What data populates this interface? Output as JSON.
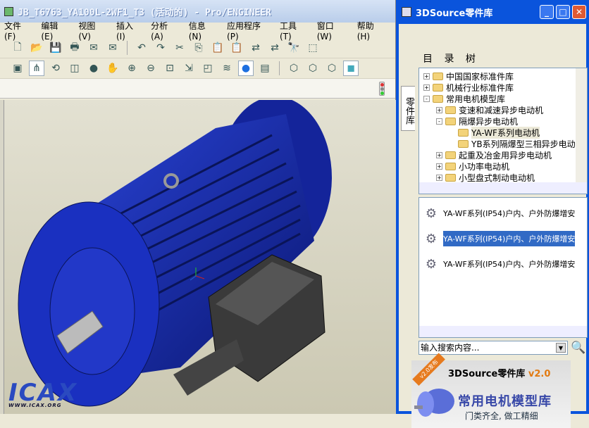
{
  "window": {
    "title": "JB_T6763_YA100L-2WF1_T3 (活动的) - Pro/ENGINEER"
  },
  "menu": [
    "文件(F)",
    "编辑(E)",
    "视图(V)",
    "插入(I)",
    "分析(A)",
    "信息(N)",
    "应用程序(P)",
    "工具(T)",
    "窗口(W)",
    "帮助(H)"
  ],
  "panel": {
    "title": "3DSource零件库",
    "side_tab": "零件库",
    "tree_header": "目 录 树",
    "tree": [
      {
        "label": "中国国家标准件库",
        "level": 0,
        "expander": "+"
      },
      {
        "label": "机械行业标准件库",
        "level": 0,
        "expander": "+"
      },
      {
        "label": "常用电机模型库",
        "level": 0,
        "expander": "-"
      },
      {
        "label": "变速和减速异步电动机",
        "level": 1,
        "expander": "+"
      },
      {
        "label": "隔爆异步电动机",
        "level": 1,
        "expander": "-"
      },
      {
        "label": "YA-WF系列电动机",
        "level": 2,
        "expander": ""
      },
      {
        "label": "YB系列隔爆型三相异步电动",
        "level": 2,
        "expander": ""
      },
      {
        "label": "起重及冶金用异步电动机",
        "level": 1,
        "expander": "+"
      },
      {
        "label": "小功率电动机",
        "level": 1,
        "expander": "+"
      },
      {
        "label": "小型盘式制动电动机",
        "level": 1,
        "expander": "+"
      }
    ],
    "list": [
      {
        "label": "YA-WF系列(IP54)户内、户外防爆增安",
        "selected": false
      },
      {
        "label": "YA-WF系列(IP54)户内、户外防爆增安",
        "selected": true
      },
      {
        "label": "YA-WF系列(IP54)户内、户外防爆增安",
        "selected": false
      }
    ],
    "search_placeholder": "输入搜索内容...",
    "banner": {
      "brand": "3DSource零件库",
      "version": "v2.0",
      "headline": "常用电机模型库",
      "slogan": "门类齐全, 做工精细",
      "ribbon": "v2.0发布"
    }
  },
  "watermark": {
    "logo": "ICAX",
    "url": "WWW.ICAX.ORG"
  },
  "colors": {
    "motor": "#1a2fb0",
    "selection": "#316ac5",
    "titlebar": "#0a54dc"
  }
}
